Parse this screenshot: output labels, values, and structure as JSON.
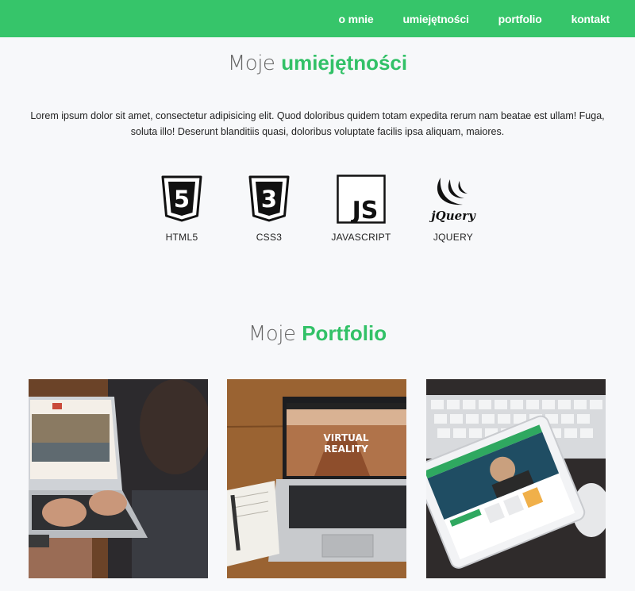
{
  "nav": {
    "items": [
      "o mnie",
      "umiejętności",
      "portfolio",
      "kontakt"
    ]
  },
  "skills_section": {
    "title_prefix": "Moje",
    "title_highlight": "umiejętności",
    "intro": "Lorem ipsum dolor sit amet, consectetur adipisicing elit. Quod doloribus quidem totam expedita rerum nam beatae est ullam! Fuga, soluta illo! Deserunt blanditiis quasi, doloribus voluptate facilis ipsa aliquam, maiores.",
    "skills": [
      {
        "label": "HTML5",
        "icon": "html5-icon",
        "glyph": "5"
      },
      {
        "label": "CSS3",
        "icon": "css3-icon",
        "glyph": "3"
      },
      {
        "label": "JAVASCRIPT",
        "icon": "javascript-icon",
        "glyph": "JS"
      },
      {
        "label": "JQUERY",
        "icon": "jquery-icon",
        "glyph": "jQuery"
      }
    ]
  },
  "portfolio_section": {
    "title_prefix": "Moje",
    "title_highlight": "Portfolio",
    "tile_text": {
      "vr_line1": "VIRTUAL",
      "vr_line2": "REALITY"
    }
  },
  "colors": {
    "accent": "#36c56a",
    "background": "#f7f8fa"
  }
}
